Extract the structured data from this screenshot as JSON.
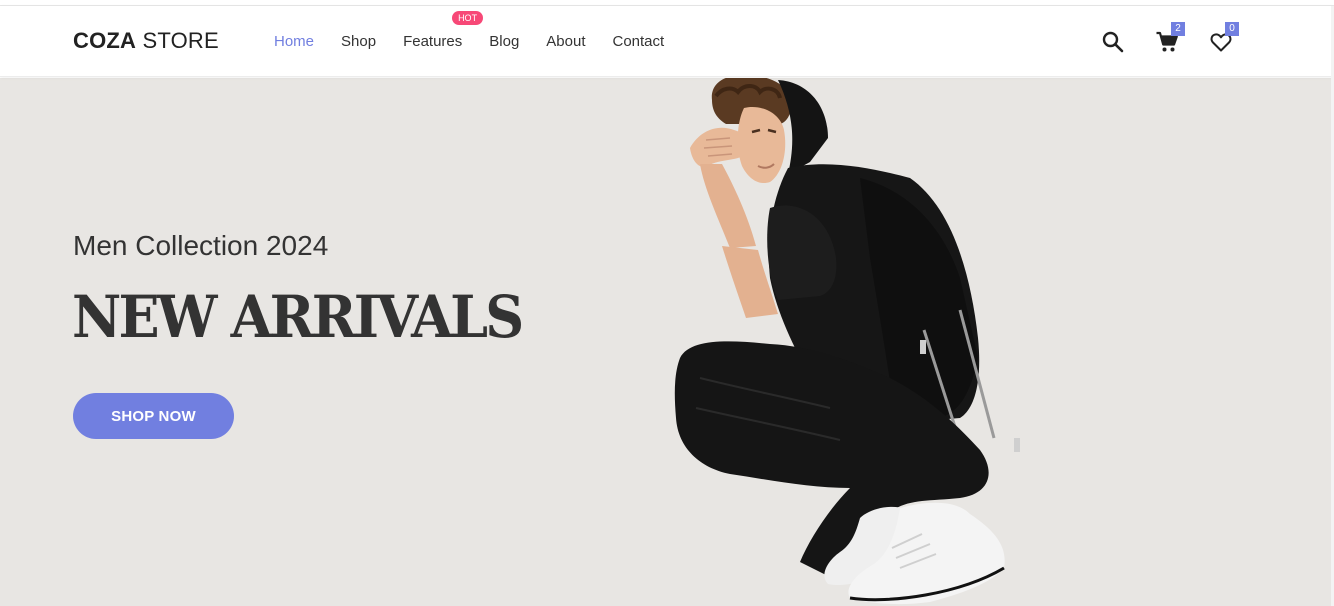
{
  "header": {
    "logo": {
      "bold": "COZA",
      "thin": " STORE"
    },
    "nav": [
      {
        "label": "Home",
        "active": true
      },
      {
        "label": "Shop"
      },
      {
        "label": "Features",
        "badge": "HOT"
      },
      {
        "label": "Blog"
      },
      {
        "label": "About"
      },
      {
        "label": "Contact"
      }
    ],
    "icons": {
      "search": "search-icon",
      "cart": "cart-icon",
      "wishlist": "heart-icon"
    },
    "cart_count": "2",
    "wishlist_count": "0"
  },
  "hero": {
    "subtitle": "Men Collection 2024",
    "headline": "NEW ARRIVALS",
    "cta_label": "SHOP NOW",
    "image": "model-photo"
  },
  "colors": {
    "accent": "#717fe0",
    "hot": "#f74877",
    "hero_bg": "#e8e6e3",
    "text": "#333333"
  }
}
